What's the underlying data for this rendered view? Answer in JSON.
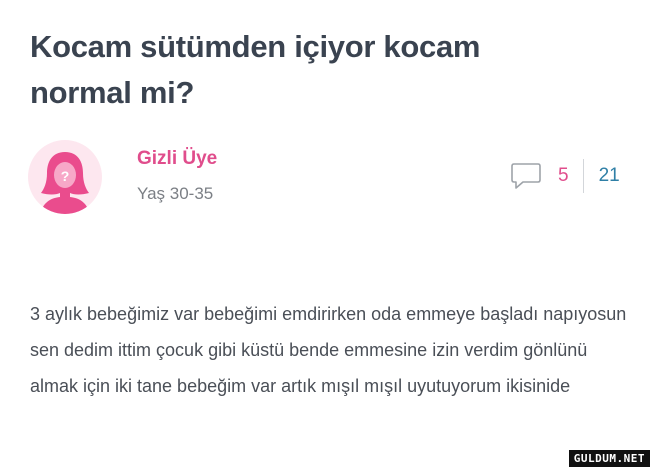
{
  "question": {
    "title": "Kocam sütümden içiyor kocam normal mi?"
  },
  "author": {
    "name": "Gizli Üye",
    "age": "Yaş 30-35",
    "avatar_icon": "anonymous-female-avatar-icon"
  },
  "stats": {
    "comments": "5",
    "views": "21",
    "comment_icon": "speech-bubble-icon"
  },
  "body": {
    "text": "3 aylık bebeğimiz var bebeğimi emdirirken oda emmeye başladı napıyosun sen dedim ittim çocuk gibi küstü bende emmesine izin verdim gönlünü almak için iki tane bebeğim var artık mışıl mışıl uyutuyorum ikisinide"
  },
  "watermark": {
    "text": "GULDUM.NET"
  },
  "colors": {
    "title": "#3a4350",
    "accent_pink": "#e04d8c",
    "accent_blue": "#2f7fa6",
    "avatar_bg": "#fde7ef",
    "body_text": "#4a4f57"
  }
}
